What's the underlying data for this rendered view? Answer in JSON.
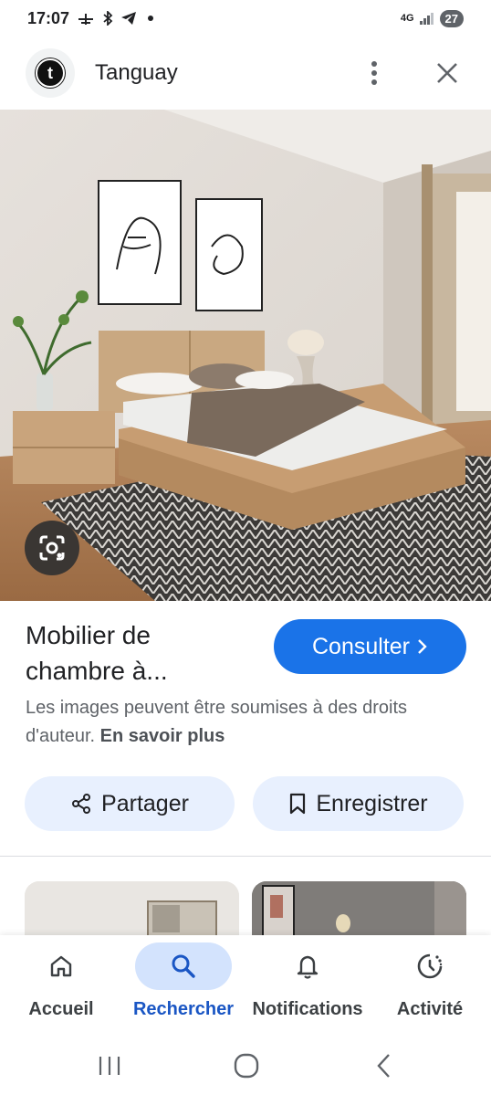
{
  "status_bar": {
    "time": "17:07",
    "network": "4G",
    "battery": "27"
  },
  "header": {
    "logo_letter": "t",
    "site_name": "Tanguay"
  },
  "result": {
    "title": "Mobilier de chambre à...",
    "visit_label": "Consulter",
    "rights_text": "Les images peuvent être soumises à des droits d'auteur.",
    "learn_more": "En savoir plus",
    "share_label": "Partager",
    "save_label": "Enregistrer"
  },
  "bottom_nav": {
    "items": [
      {
        "label": "Accueil",
        "icon": "home-icon",
        "active": false
      },
      {
        "label": "Rechercher",
        "icon": "search-icon",
        "active": true
      },
      {
        "label": "Notifications",
        "icon": "bell-icon",
        "active": false
      },
      {
        "label": "Activité",
        "icon": "activity-icon",
        "active": false
      }
    ]
  },
  "colors": {
    "accent": "#1a73e8",
    "pill_bg": "#e8f0fe",
    "active_nav_bg": "#d3e3fd"
  }
}
